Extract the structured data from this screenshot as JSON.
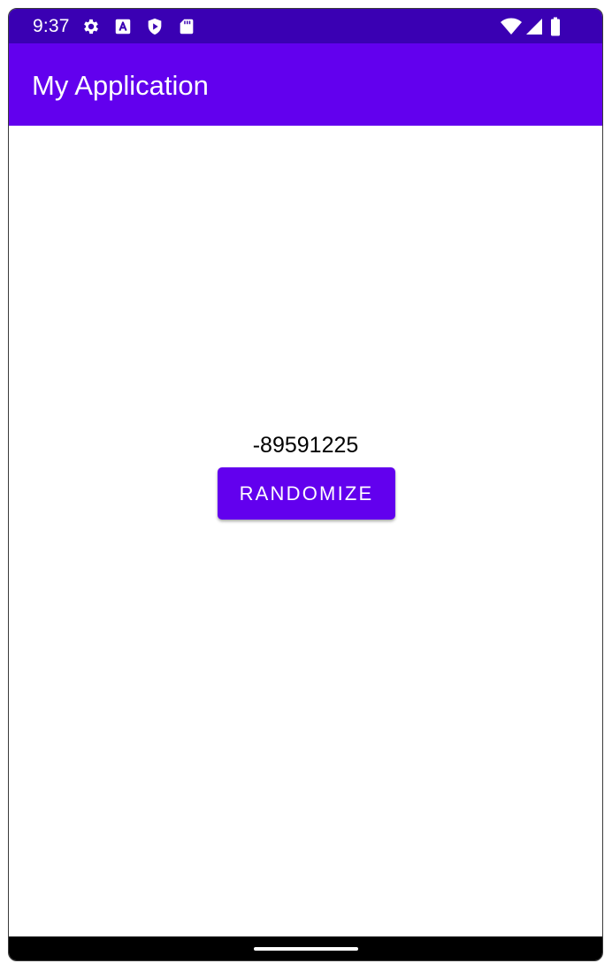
{
  "status_bar": {
    "time": "9:37",
    "background": "#3a00b3",
    "icons_left": [
      "settings-gear-icon",
      "a-box-icon",
      "play-shield-icon",
      "sd-card-icon"
    ],
    "icons_right": [
      "wifi-icon",
      "cellular-signal-icon",
      "battery-icon"
    ]
  },
  "app_bar": {
    "title": "My Application",
    "background": "#6200ee"
  },
  "main": {
    "number_text": "-89591225",
    "button_label": "RANDOMIZE",
    "accent_color": "#6200ee"
  },
  "navigation_bar": {
    "background": "#000000",
    "handle": "home-gesture-handle"
  }
}
